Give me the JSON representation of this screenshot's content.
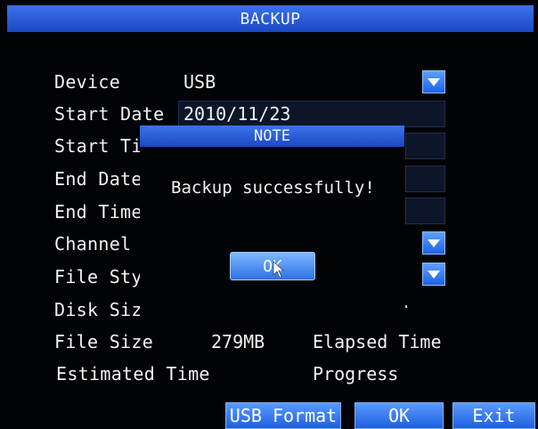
{
  "window": {
    "title": "BACKUP"
  },
  "form": {
    "device_label": "Device",
    "device_value": "USB",
    "start_date_label": "Start Date",
    "start_date_value": "2010/11/23",
    "start_time_label": "Start Ti",
    "end_date_label": "End Date",
    "end_time_label": "End Time",
    "channel_label": "Channel",
    "file_style_label": "File Sty",
    "disk_size_label": "Disk Siz",
    "file_size_label": "File Size",
    "file_size_value": "279MB",
    "elapsed_time_label": "Elapsed Time",
    "estimated_time_label": "Estimated Time",
    "progress_label": "Progress"
  },
  "dialog": {
    "title": "NOTE",
    "message": "Backup successfully!",
    "ok_label": "OK"
  },
  "footer": {
    "usb_format_label": "USB Format",
    "ok_label": "OK",
    "exit_label": "Exit"
  },
  "icons": {
    "dropdown": "chevron-down-icon",
    "pointer": "mouse-pointer-icon"
  },
  "colors": {
    "accent_blue": "#2a5fe0",
    "background": "#020306",
    "text": "#f2f2f2"
  }
}
